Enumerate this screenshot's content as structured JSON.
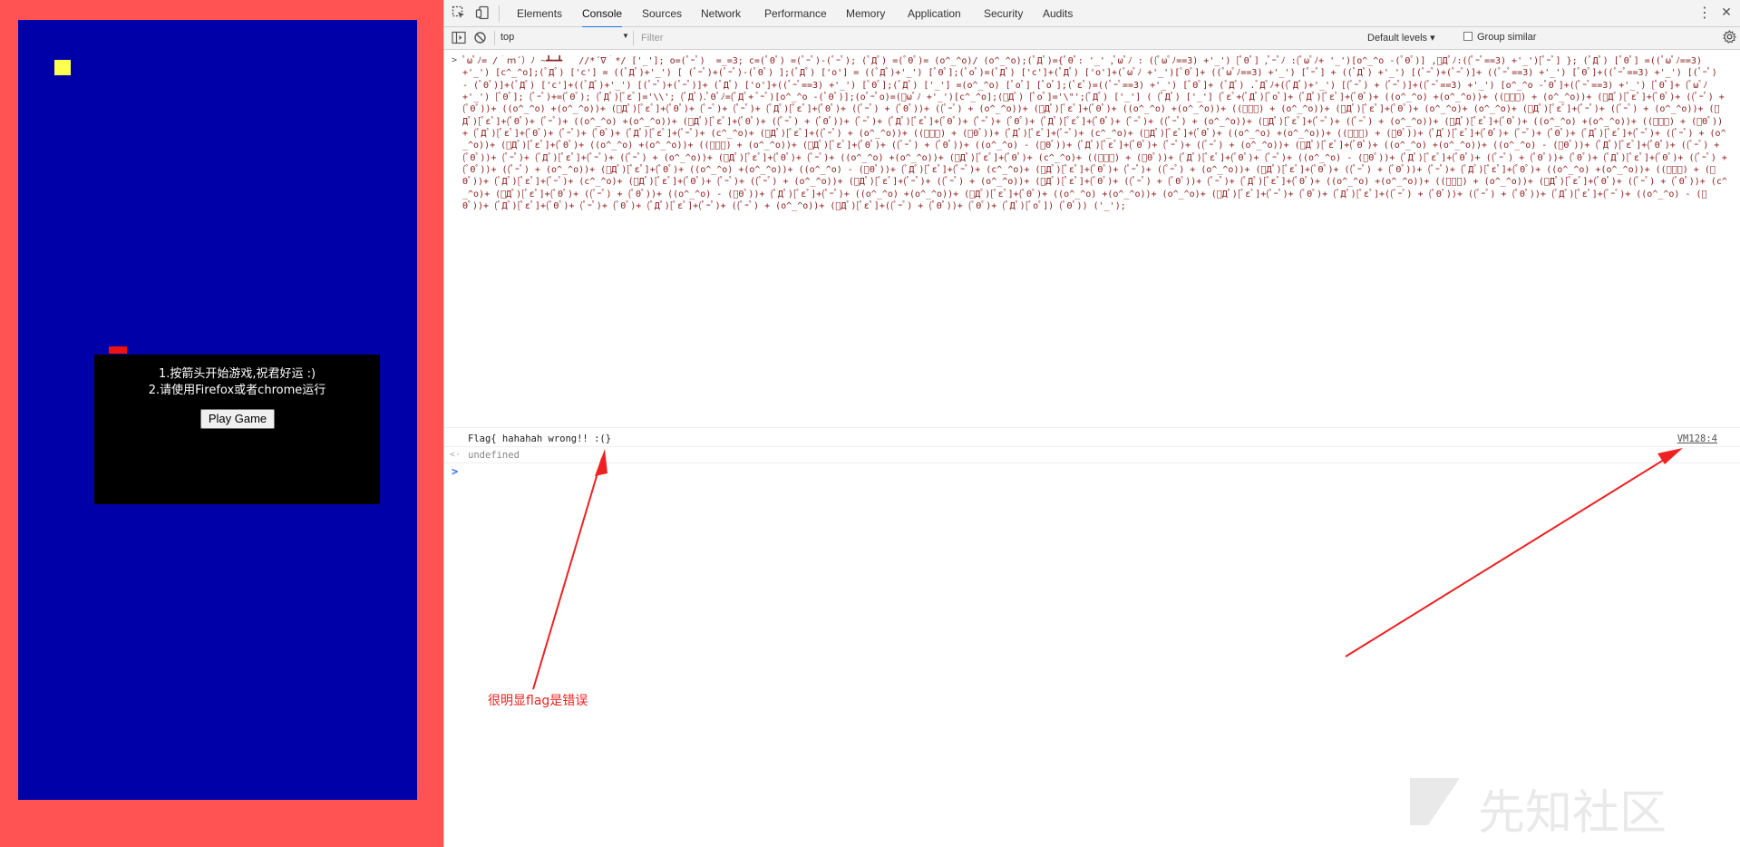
{
  "game": {
    "instruction_line1": "1.按箭头开始游戏,祝君好运 :)",
    "instruction_line2": "2.请使用Firefox或者chrome运行",
    "play_button": "Play Game",
    "colors": {
      "page_bg": "#ff5252",
      "canvas_bg": "#0000a8",
      "player": "#ffff4d",
      "dialog_bg": "#000000"
    }
  },
  "devtools": {
    "tabs": [
      "Elements",
      "Console",
      "Sources",
      "Network",
      "Performance",
      "Memory",
      "Application",
      "Security",
      "Audits"
    ],
    "active_tab": "Console",
    "toolbar": {
      "context": "top",
      "filter_placeholder": "Filter",
      "levels": "Default levels ▾",
      "group_similar": "Group similar"
    },
    "console": {
      "input_prompt": ">",
      "code": "ﾟωﾟﾉ= /｀ｍ´）ﾉ ~┻━┻   //*´∇｀*/ ['_']; o=(ﾟｰﾟ)  =_=3; c=(ﾟΘﾟ) =(ﾟｰﾟ)-(ﾟｰﾟ); (ﾟДﾟ) =(ﾟΘﾟ)= (o^_^o)/ (o^_^o);(ﾟДﾟ)={ﾟΘﾟ: '_' ,ﾟωﾟﾉ : ((ﾟωﾟﾉ==3) +'_') [ﾟΘﾟ] ,ﾟｰﾟﾉ :(ﾟωﾟﾉ+ '_')[o^_^o -(ﾟΘﾟ)] ,ﾟДﾟﾉ:((ﾟｰﾟ==3) +'_')[ﾟｰﾟ] }; (ﾟДﾟ) [ﾟΘﾟ] =((ﾟωﾟﾉ==3) +'_') [c^_^o];(ﾟДﾟ) ['c'] = ((ﾟДﾟ)+'_') [ (ﾟｰﾟ)+(ﾟｰﾟ)-(ﾟΘﾟ) ];(ﾟДﾟ) ['o'] = ((ﾟДﾟ)+'_') [ﾟΘﾟ];(ﾟoﾟ)=(ﾟДﾟ) ['c']+(ﾟДﾟ) ['o']+(ﾟωﾟﾉ +'_')[ﾟΘﾟ]+ ((ﾟωﾟﾉ==3) +'_') [ﾟｰﾟ] + ((ﾟДﾟ) +'_') [(ﾟｰﾟ)+(ﾟｰﾟ)]+ ((ﾟｰﾟ==3) +'_') [ﾟΘﾟ]+((ﾟｰﾟ==3) +'_') [(ﾟｰﾟ) - (ﾟΘﾟ)]+(ﾟДﾟ) ['c']+((ﾟДﾟ)+'_') [(ﾟｰﾟ)+(ﾟｰﾟ)]+ (ﾟДﾟ) ['o']+((ﾟｰﾟ==3) +'_') [ﾟΘﾟ];(ﾟДﾟ) ['_'] =(o^_^o) [ﾟoﾟ] [ﾟoﾟ];(ﾟεﾟ)=((ﾟｰﾟ==3) +'_') [ﾟΘﾟ]+ (ﾟДﾟ) .ﾟДﾟﾉ+((ﾟДﾟ)+'_') [(ﾟｰﾟ) + (ﾟｰﾟ)]+((ﾟｰﾟ==3) +'_') [o^_^o -ﾟΘﾟ]+((ﾟｰﾟ==3) +'_') [ﾟΘﾟ]+ (ﾟωﾟﾉ +'_') [ﾟΘﾟ]; (ﾟｰﾟ)+=(ﾟΘﾟ); (ﾟДﾟ)[ﾟεﾟ]='\\\\'; (ﾟДﾟ).ﾟΘﾟﾉ=(ﾟДﾟ+ ﾟｰﾟ)[o^_^o -(ﾟΘﾟ)];(oﾟｰﾟo)=(ﾟωﾟﾉ +'_')[c^_^o];(ﾟДﾟ) [ﾟoﾟ]='\\\"';(ﾟДﾟ) ['_'] ( (ﾟДﾟ) ['_'] (ﾟεﾟ+(ﾟДﾟ)[ﾟoﾟ]+ (ﾟДﾟ)[ﾟεﾟ]+(ﾟΘﾟ)+ ((o^_^o) +(o^_^o))+ ((ﾟｰﾟ) + (o^_^o))+ (ﾟДﾟ)[ﾟεﾟ]+(ﾟΘﾟ)+ ((ﾟｰﾟ) + (ﾟΘﾟ))+ ((o^_^o) +(o^_^o))+ (ﾟДﾟ)[ﾟεﾟ]+(ﾟΘﾟ)+ (ﾟｰﾟ)+ (ﾟｰﾟ)+ (ﾟДﾟ)[ﾟεﾟ]+(ﾟΘﾟ)+ ((ﾟｰﾟ) + (ﾟΘﾟ))+ ((ﾟｰﾟ) + (o^_^o))+ (ﾟДﾟ)[ﾟεﾟ]+(ﾟΘﾟ)+ ((o^_^o) +(o^_^o))+ ((ﾟｰﾟ) + (o^_^o))+ (ﾟДﾟ)[ﾟεﾟ]+(ﾟΘﾟ)+ (o^_^o)+ (o^_^o)+ (ﾟДﾟ)[ﾟεﾟ]+(ﾟｰﾟ)+ ((ﾟｰﾟ) + (o^_^o))+ (ﾟДﾟ)[ﾟεﾟ]+(ﾟΘﾟ)+ (ﾟｰﾟ)+ ((o^_^o) +(o^_^o))+ (ﾟДﾟ)[ﾟεﾟ]+(ﾟΘﾟ)+ ((ﾟｰﾟ) + (ﾟΘﾟ))+ (ﾟｰﾟ)+ (ﾟДﾟ)[ﾟεﾟ]+(ﾟΘﾟ)+ (ﾟｰﾟ)+ (ﾟΘﾟ)+ (ﾟДﾟ)[ﾟεﾟ]+(ﾟΘﾟ)+ (ﾟｰﾟ)+ ((ﾟｰﾟ) + (o^_^o))+ (ﾟДﾟ)[ﾟεﾟ]+(ﾟｰﾟ)+ ((ﾟｰﾟ) + (o^_^o))+ (ﾟДﾟ)[ﾟεﾟ]+(ﾟΘﾟ)+ ((o^_^o) +(o^_^o))+ ((ﾟｰﾟ) + (ﾟΘﾟ))+ (ﾟДﾟ)[ﾟεﾟ]+(ﾟΘﾟ)+ (ﾟｰﾟ)+ (ﾟΘﾟ)+ (ﾟДﾟ)[ﾟεﾟ]+(ﾟｰﾟ)+ (c^_^o)+ (ﾟДﾟ)[ﾟεﾟ]+((ﾟｰﾟ) + (o^_^o))+ ((ﾟｰﾟ) + (ﾟΘﾟ))+ (ﾟДﾟ)[ﾟεﾟ]+(ﾟｰﾟ)+ (c^_^o)+ (ﾟДﾟ)[ﾟεﾟ]+(ﾟΘﾟ)+ ((o^_^o) +(o^_^o))+ ((ﾟｰﾟ) + (ﾟΘﾟ))+ (ﾟДﾟ)[ﾟεﾟ]+(ﾟΘﾟ)+ (ﾟｰﾟ)+ (ﾟΘﾟ)+ (ﾟДﾟ)[ﾟεﾟ]+(ﾟｰﾟ)+ ((ﾟｰﾟ) + (o^_^o))+ (ﾟДﾟ)[ﾟεﾟ]+(ﾟΘﾟ)+ ((o^_^o) +(o^_^o))+ ((ﾟｰﾟ) + (o^_^o))+ (ﾟДﾟ)[ﾟεﾟ]+(ﾟΘﾟ)+ ((ﾟｰﾟ) + (ﾟΘﾟ))+ ((o^_^o) - (ﾟΘﾟ))+ (ﾟДﾟ)[ﾟεﾟ]+(ﾟΘﾟ)+ (ﾟｰﾟ)+ ((ﾟｰﾟ) + (o^_^o))+ (ﾟДﾟ)[ﾟεﾟ]+(ﾟΘﾟ)+ ((o^_^o) +(o^_^o))+ ((o^_^o) - (ﾟΘﾟ))+ (ﾟДﾟ)[ﾟεﾟ]+(ﾟΘﾟ)+ ((ﾟｰﾟ) + (ﾟΘﾟ))+ (ﾟｰﾟ)+ (ﾟДﾟ)[ﾟεﾟ]+(ﾟｰﾟ)+ ((ﾟｰﾟ) + (o^_^o))+ (ﾟДﾟ)[ﾟεﾟ]+(ﾟΘﾟ)+ (ﾟｰﾟ)+ ((o^_^o) +(o^_^o))+ (ﾟДﾟ)[ﾟεﾟ]+(ﾟΘﾟ)+ (c^_^o)+ ((ﾟｰﾟ) + (ﾟΘﾟ))+ (ﾟДﾟ)[ﾟεﾟ]+(ﾟΘﾟ)+ (ﾟｰﾟ)+ ((o^_^o) - (ﾟΘﾟ))+ (ﾟДﾟ)[ﾟεﾟ]+(ﾟΘﾟ)+ ((ﾟｰﾟ) + (ﾟΘﾟ))+ (ﾟΘﾟ)+ (ﾟДﾟ)[ﾟεﾟ]+(ﾟΘﾟ)+ ((ﾟｰﾟ) + (ﾟΘﾟ))+ ((ﾟｰﾟ) + (o^_^o))+ (ﾟДﾟ)[ﾟεﾟ]+(ﾟΘﾟ)+ ((o^_^o) +(o^_^o))+ ((o^_^o) - (ﾟΘﾟ))+ (ﾟДﾟ)[ﾟεﾟ]+(ﾟｰﾟ)+ (c^_^o)+ (ﾟДﾟ)[ﾟεﾟ]+(ﾟΘﾟ)+ (ﾟｰﾟ)+ ((ﾟｰﾟ) + (o^_^o))+ (ﾟДﾟ)[ﾟεﾟ]+(ﾟΘﾟ)+ ((ﾟｰﾟ) + (ﾟΘﾟ))+ (ﾟｰﾟ)+ (ﾟДﾟ)[ﾟεﾟ]+(ﾟΘﾟ)+ ((o^_^o) +(o^_^o))+ ((ﾟｰﾟ) + (ﾟΘﾟ))+ (ﾟДﾟ)[ﾟεﾟ]+(ﾟｰﾟ)+ (c^_^o)+ (ﾟДﾟ)[ﾟεﾟ]+(ﾟΘﾟ)+ (ﾟｰﾟ)+ ((ﾟｰﾟ) + (o^_^o))+ (ﾟДﾟ)[ﾟεﾟ]+(ﾟｰﾟ)+ ((ﾟｰﾟ) + (o^_^o))+ (ﾟДﾟ)[ﾟεﾟ]+(ﾟΘﾟ)+ ((ﾟｰﾟ) + (ﾟΘﾟ))+ (ﾟｰﾟ)+ (ﾟДﾟ)[ﾟεﾟ]+(ﾟΘﾟ)+ ((o^_^o) +(o^_^o))+ ((ﾟｰﾟ) + (o^_^o))+ (ﾟДﾟ)[ﾟεﾟ]+(ﾟΘﾟ)+ ((ﾟｰﾟ) + (ﾟΘﾟ))+ (c^_^o)+ (ﾟДﾟ)[ﾟεﾟ]+(ﾟΘﾟ)+ ((ﾟｰﾟ) + (ﾟΘﾟ))+ ((o^_^o) - (ﾟΘﾟ))+ (ﾟДﾟ)[ﾟεﾟ]+(ﾟｰﾟ)+ ((o^_^o) +(o^_^o))+ (ﾟДﾟ)[ﾟεﾟ]+(ﾟΘﾟ)+ ((o^_^o) +(o^_^o))+ (o^_^o)+ (ﾟДﾟ)[ﾟεﾟ]+(ﾟｰﾟ)+ (ﾟΘﾟ)+ (ﾟДﾟ)[ﾟεﾟ]+((ﾟｰﾟ) + (ﾟΘﾟ))+ ((ﾟｰﾟ) + (ﾟΘﾟ))+ (ﾟДﾟ)[ﾟεﾟ]+(ﾟｰﾟ)+ ((o^_^o) - (ﾟΘﾟ))+ (ﾟДﾟ)[ﾟεﾟ]+(ﾟΘﾟ)+ (ﾟｰﾟ)+ (ﾟΘﾟ)+ (ﾟДﾟ)[ﾟεﾟ]+(ﾟｰﾟ)+ ((ﾟｰﾟ) + (o^_^o))+ (ﾟДﾟ)[ﾟεﾟ]+((ﾟｰﾟ) + (ﾟΘﾟ))+ (ﾟΘﾟ)+ (ﾟДﾟ)[ﾟoﾟ]) (ﾟΘﾟ)) ('_');",
      "output_text": "Flag{ hahahah wrong!! :(}",
      "output_source": "VM128:4",
      "return_marker": "<·",
      "return_value": "undefined",
      "cursor_prompt": ">"
    }
  },
  "annotation": {
    "text": "很明显flag是错误",
    "color": "#ee2222"
  },
  "watermark": {
    "text": "先知社区"
  }
}
